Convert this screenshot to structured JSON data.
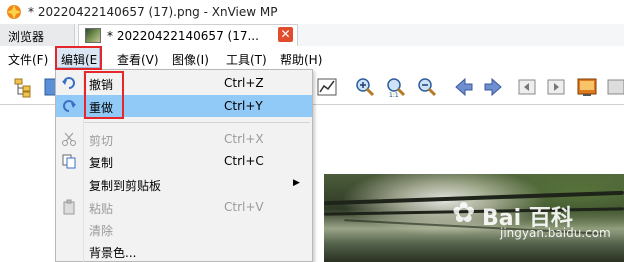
{
  "window": {
    "title": "* 20220422140657 (17).png - XnView MP"
  },
  "tabs": [
    {
      "label": "浏览器"
    },
    {
      "label": "* 20220422140657 (17..."
    }
  ],
  "menubar": {
    "items": [
      "文件(F)",
      "编辑(E",
      "查看(V)",
      "图像(I)",
      "工具(T)",
      "帮助(H)"
    ]
  },
  "edit_menu": {
    "items": [
      {
        "label": "撤销",
        "shortcut": "Ctrl+Z",
        "enabled": true,
        "icon": "undo-icon"
      },
      {
        "label": "重做",
        "shortcut": "Ctrl+Y",
        "enabled": true,
        "icon": "redo-icon",
        "highlighted": true
      },
      {
        "label": "剪切",
        "shortcut": "Ctrl+X",
        "enabled": false,
        "icon": "cut-icon"
      },
      {
        "label": "复制",
        "shortcut": "Ctrl+C",
        "enabled": true,
        "icon": "copy-icon"
      },
      {
        "label": "复制到剪贴板",
        "shortcut": "",
        "enabled": true,
        "submenu": true
      },
      {
        "label": "粘贴",
        "shortcut": "Ctrl+V",
        "enabled": false,
        "icon": "paste-icon"
      },
      {
        "label": "清除",
        "shortcut": "",
        "enabled": false
      },
      {
        "label": "背景色...",
        "shortcut": "",
        "enabled": true
      }
    ]
  },
  "watermark": {
    "brand": "Bai  百科",
    "url": "jingyan.baidu.com"
  },
  "colors": {
    "highlight": "#91c9f7",
    "annotation": "#e5262a",
    "tab_close": "#e04c2c"
  }
}
